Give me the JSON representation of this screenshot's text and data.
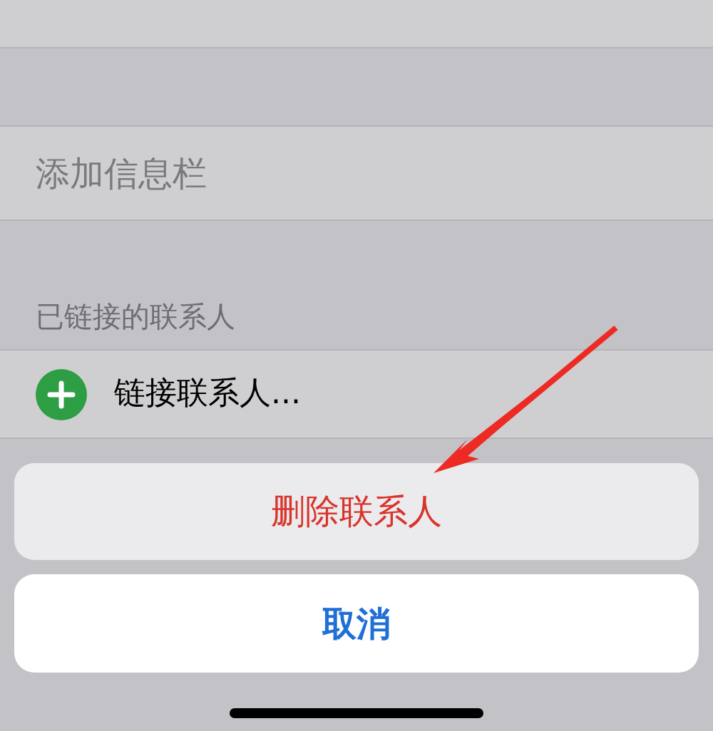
{
  "list": {
    "add_field_row": {
      "label": "添加信息栏"
    },
    "linked_contacts": {
      "header": "已链接的联系人",
      "link_row": {
        "label": "链接联系人..."
      }
    }
  },
  "action_sheet": {
    "actions": [
      {
        "label": "删除联系人",
        "kind": "destructive"
      }
    ],
    "cancel": {
      "label": "取消"
    }
  }
}
